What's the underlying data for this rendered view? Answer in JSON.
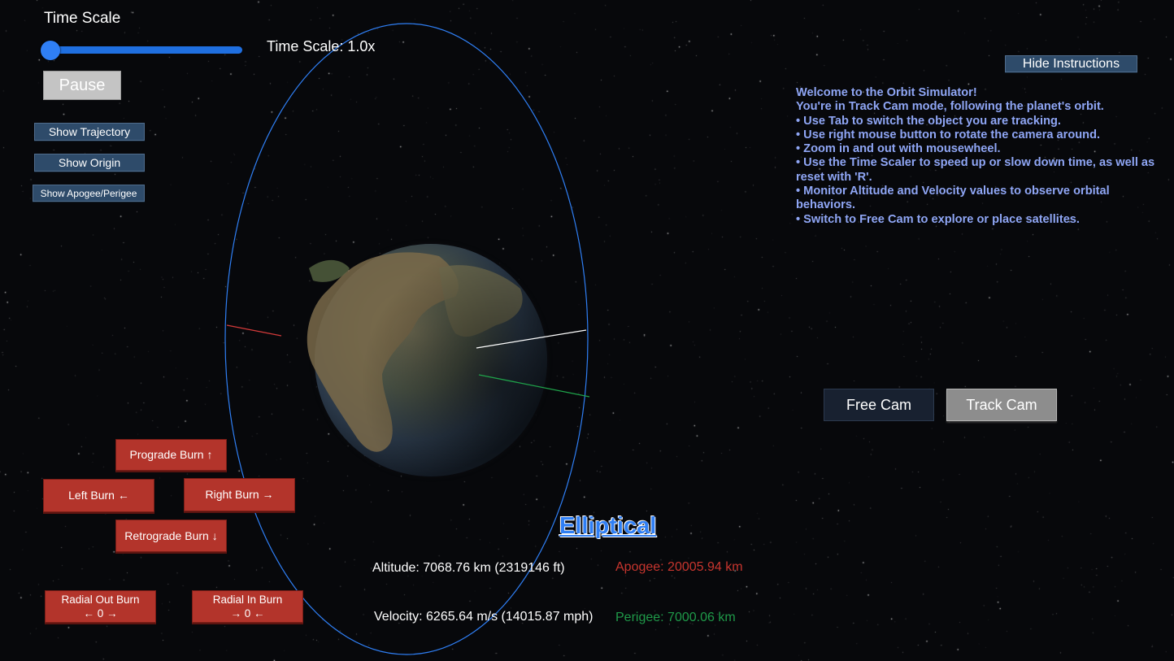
{
  "time_scale": {
    "title": "Time Scale",
    "readout": "Time Scale: 1.0x",
    "value": 1.0,
    "slider_fraction": 0.0
  },
  "controls": {
    "pause_label": "Pause",
    "show_trajectory_label": "Show Trajectory",
    "show_origin_label": "Show Origin",
    "show_apogee_perigee_label": "Show Apogee/Perigee",
    "hide_instructions_label": "Hide Instructions"
  },
  "instructions": {
    "lines": [
      "Welcome to the Orbit Simulator!",
      "",
      "You're in Track Cam mode, following the planet's orbit.",
      "• Use Tab to switch the object you are tracking.",
      "• Use right mouse button to rotate the camera around.",
      "• Zoom in and out with mousewheel.",
      "• Use the Time Scaler to speed up or slow down time, as well as reset with 'R'.",
      "• Monitor Altitude and Velocity values to observe orbital behaviors.",
      "• Switch to Free Cam to explore or place satellites."
    ]
  },
  "camera": {
    "free_cam_label": "Free Cam",
    "track_cam_label": "Track Cam",
    "active": "Track Cam"
  },
  "burns": {
    "prograde": "Prograde Burn ↑",
    "left": "Left Burn ←",
    "right": "Right Burn →",
    "retrograde": "Retrograde Burn ↓",
    "radial_out_title": "Radial Out Burn",
    "radial_out_glyph": "← 0 →",
    "radial_in_title": "Radial In Burn",
    "radial_in_glyph": "→ 0 ←"
  },
  "telemetry": {
    "orbit_type": "Elliptical",
    "altitude": "Altitude: 7068.76 km (2319146 ft)",
    "velocity": "Velocity: 6265.64 m/s (14015.87 mph)",
    "apogee": "Apogee: 20005.94 km",
    "perigee": "Perigee: 7000.06 km"
  },
  "colors": {
    "orbit_line": "#2f7ff5",
    "instructions_text": "#8fa6f5",
    "burn_button": "#b3342b",
    "apogee": "#c7352e",
    "perigee": "#1f9a49",
    "axis_red": "#d23a3a",
    "axis_green": "#1fa24a",
    "axis_white": "#ffffff"
  }
}
